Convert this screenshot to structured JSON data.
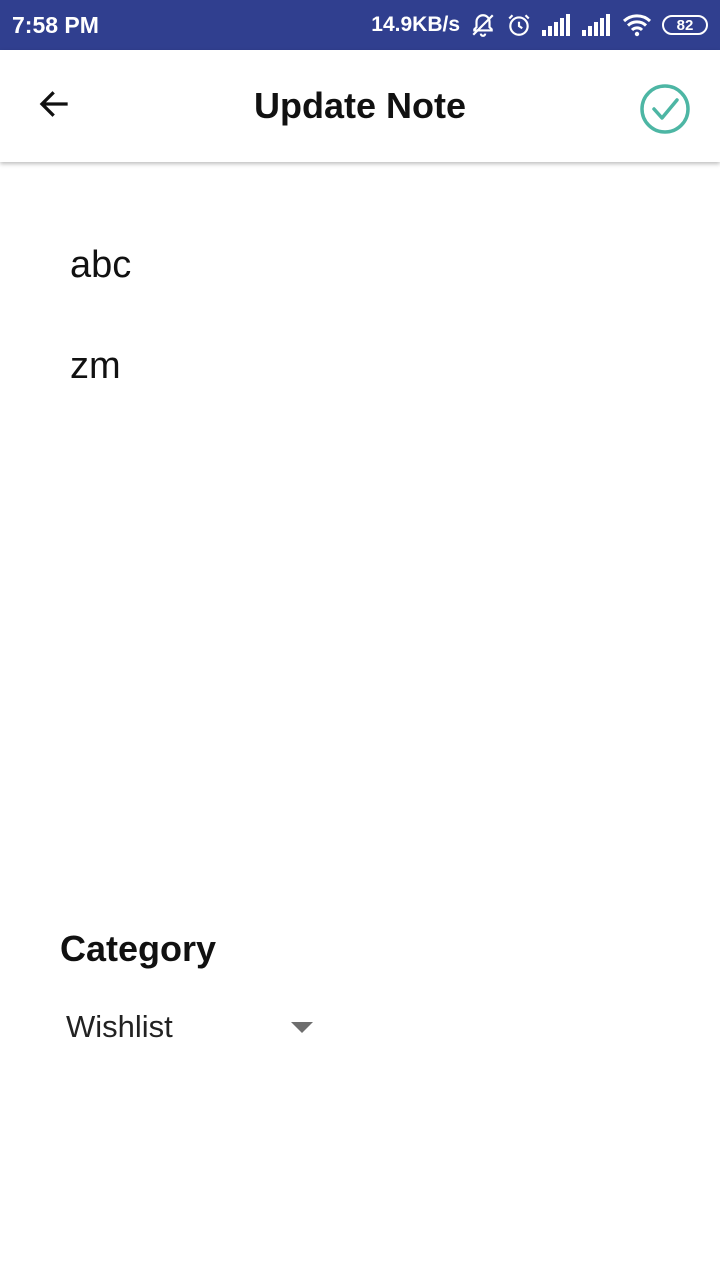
{
  "status_bar": {
    "time": "7:58 PM",
    "network_speed": "14.9KB/s",
    "battery": "82",
    "icons": [
      "notifications-off-icon",
      "alarm-icon",
      "signal-icon",
      "signal-icon",
      "wifi-icon",
      "battery-icon"
    ]
  },
  "app_bar": {
    "title": "Update Note",
    "back_icon": "arrow-back-icon",
    "save_icon": "check-circle-icon",
    "accent_color": "#4db6a4"
  },
  "note": {
    "title_value": "abc",
    "body_value": "zm"
  },
  "category": {
    "label": "Category",
    "selected": "Wishlist"
  },
  "colors": {
    "status_bar_bg": "#303f8f",
    "check_accent": "#4db6a4"
  }
}
